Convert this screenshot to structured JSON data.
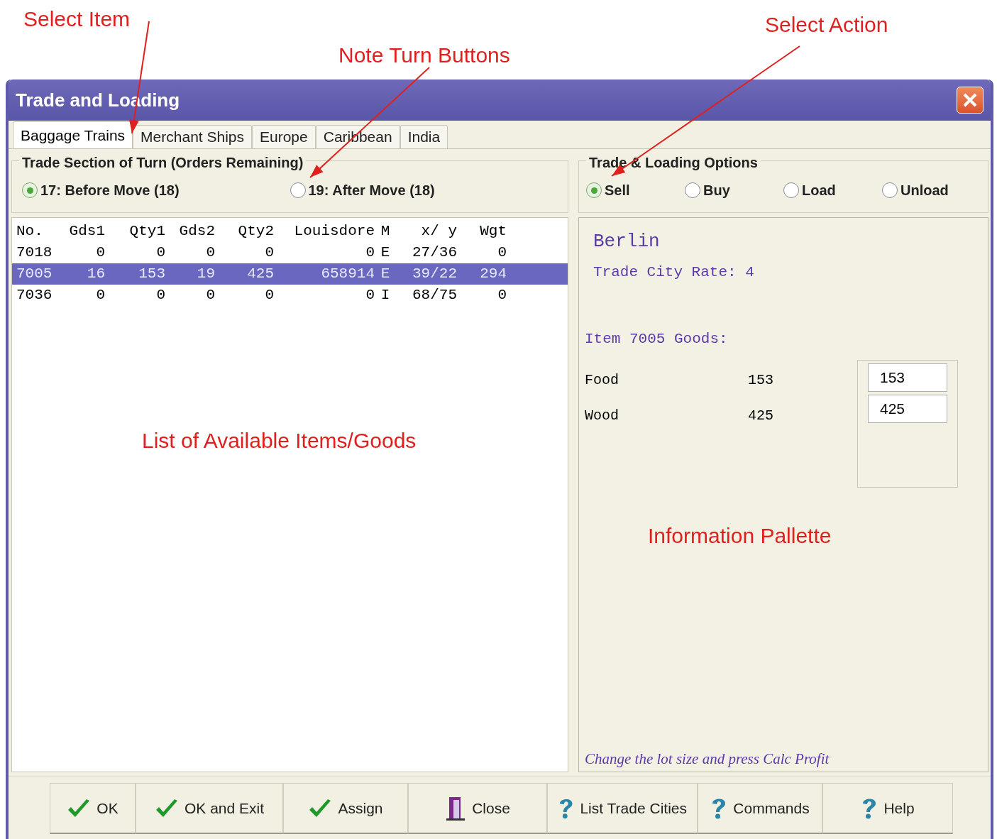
{
  "annotations": [
    {
      "text": "Select Item"
    },
    {
      "text": "Note Turn Buttons"
    },
    {
      "text": "Select Action"
    },
    {
      "text": "List of Available Items/Goods"
    },
    {
      "text": "Information Pallette"
    }
  ],
  "window": {
    "title": "Trade and Loading"
  },
  "tabs": [
    {
      "label": "Baggage Trains",
      "selected": true
    },
    {
      "label": "Merchant Ships",
      "selected": false
    },
    {
      "label": "Europe",
      "selected": false
    },
    {
      "label": "Caribbean",
      "selected": false
    },
    {
      "label": "India",
      "selected": false
    }
  ],
  "turn_section": {
    "title": "Trade Section of Turn (Orders Remaining)",
    "options": [
      {
        "label": "17: Before Move (18)",
        "selected": true
      },
      {
        "label": "19: After Move (18)",
        "selected": false
      }
    ]
  },
  "table": {
    "columns": [
      "No.",
      "Gds1",
      "Qty1",
      "Gds2",
      "Qty2",
      "Louisdore",
      "M",
      "x/ y",
      "Wgt"
    ],
    "rows": [
      {
        "cells": [
          "7018",
          "0",
          "0",
          "0",
          "0",
          "0",
          "E",
          "27/36",
          "0"
        ],
        "selected": false
      },
      {
        "cells": [
          "7005",
          "16",
          "153",
          "19",
          "425",
          "658914",
          "E",
          "39/22",
          "294"
        ],
        "selected": true
      },
      {
        "cells": [
          "7036",
          "0",
          "0",
          "0",
          "0",
          "0",
          "I",
          "68/75",
          "0"
        ],
        "selected": false
      }
    ]
  },
  "options": {
    "title": "Trade & Loading Options",
    "choices": [
      {
        "label": "Sell",
        "selected": true
      },
      {
        "label": "Buy",
        "selected": false
      },
      {
        "label": "Load",
        "selected": false
      },
      {
        "label": "Unload",
        "selected": false
      }
    ]
  },
  "info": {
    "city": "Berlin",
    "rate": "Trade City Rate: 4",
    "item_heading": "Item 7005 Goods:",
    "goods": [
      {
        "name": "Food",
        "quantity": "153",
        "value": "153"
      },
      {
        "name": "Wood",
        "quantity": "425",
        "value": "425"
      }
    ],
    "hint": "Change the lot size and press Calc Profit"
  },
  "buttons": [
    {
      "label": "OK",
      "kind": "confirm"
    },
    {
      "label": "OK and Exit",
      "kind": "confirm"
    },
    {
      "label": "Assign",
      "kind": "confirm"
    },
    {
      "label": "Close",
      "kind": "exit"
    },
    {
      "label": "List Trade Cities",
      "kind": "info"
    },
    {
      "label": "Commands",
      "kind": "info"
    },
    {
      "label": "Help",
      "kind": "info"
    }
  ]
}
